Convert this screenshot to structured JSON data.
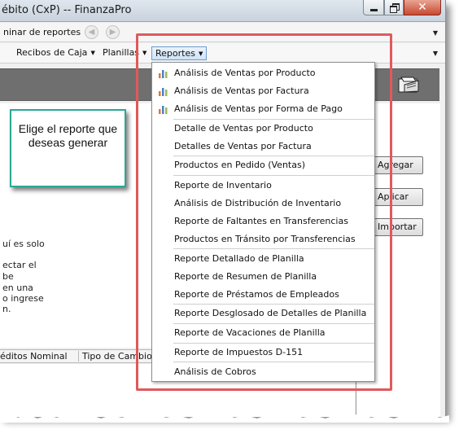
{
  "window": {
    "title": "ébito (CxP) -- FinanzaPro",
    "close_glyph": "✕"
  },
  "tabrow": {
    "tab_label": "ninar de reportes",
    "back_glyph": "◀",
    "forward_glyph": "▶",
    "dropdown_glyph": "▼"
  },
  "menubar": {
    "items": [
      {
        "label": "Recibos de Caja",
        "caret": "▼"
      },
      {
        "label": "Planillas",
        "caret": "▼"
      },
      {
        "label": "Reportes",
        "caret": "▼"
      }
    ],
    "dropdown_glyph": "▼"
  },
  "callout": {
    "text": "Elige el reporte que deseas generar"
  },
  "side_buttons": {
    "agregar": "Agregar",
    "aplicar": "Aplicar",
    "importar": "Importar"
  },
  "partial_text": {
    "line1": "uí es solo",
    "line2": "ectar el",
    "line3": "be",
    "line4": "en una",
    "line5": "o ingrese",
    "line6": "n."
  },
  "grid": {
    "col1": "éditos Nominal",
    "col2": "Tipo de Cambio"
  },
  "reportes_menu": {
    "items": [
      {
        "label": "Análisis de Ventas por Producto",
        "icon": "bar-chart-icon"
      },
      {
        "label": "Análisis de Ventas por Factura",
        "icon": "bar-chart-icon"
      },
      {
        "label": "Análisis de Ventas por Forma de Pago",
        "icon": "bar-chart-icon"
      },
      {
        "label": "Detalle de Ventas por Producto"
      },
      {
        "label": "Detalles de Ventas por Factura"
      },
      {
        "label": "Productos en Pedido (Ventas)"
      },
      {
        "label": "Reporte de Inventario"
      },
      {
        "label": "Análisis de Distribución de Inventario"
      },
      {
        "label": "Reporte de Faltantes en Transferencias"
      },
      {
        "label": "Productos en Tránsito por Transferencias"
      },
      {
        "label": "Reporte Detallado de Planilla"
      },
      {
        "label": "Reporte de Resumen de Planilla"
      },
      {
        "label": "Reporte de Préstamos de Empleados"
      },
      {
        "label": "Reporte Desglosado de Detalles de Planilla"
      },
      {
        "label": "Reporte de Vacaciones de Planilla"
      },
      {
        "label": "Reporte de Impuestos D-151"
      },
      {
        "label": "Análisis de Cobros"
      }
    ]
  },
  "colors": {
    "highlight": "#e0595c",
    "callout_border": "#2aa893",
    "band": "#6f6f6f",
    "menu_active": "#cfe3f8"
  }
}
